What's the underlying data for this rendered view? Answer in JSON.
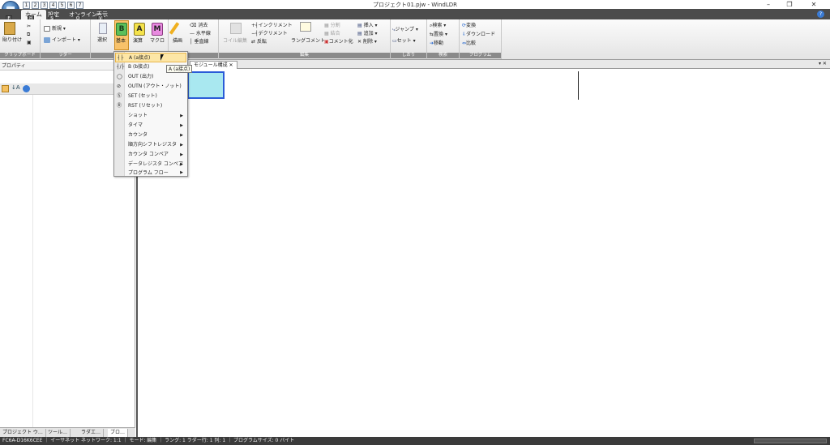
{
  "window": {
    "title": "プロジェクト01.pjw - WindLDR",
    "minimize": "–",
    "restore": "❐",
    "close": "✕"
  },
  "qat": [
    "1",
    "2",
    "3",
    "4",
    "5",
    "6",
    "7"
  ],
  "tabs": [
    {
      "label": "ホーム",
      "key": "H"
    },
    {
      "label": "設定",
      "key": "S"
    },
    {
      "label": "オンライン",
      "key": "O"
    },
    {
      "label": "表示",
      "key": "V"
    }
  ],
  "ribbon": {
    "clipboard": {
      "label": "クリップボード",
      "paste": "貼り付け"
    },
    "ladder": {
      "label": "ラダー",
      "new": "新規",
      "import": "インポート"
    },
    "instructions": {
      "select": "選択",
      "basic": "基本",
      "calc": "演算",
      "macro": "マクロ",
      "draw": "描画",
      "erase": "消去",
      "hline": "水平線",
      "vline": "垂直線",
      "basic_key": "B",
      "calc_key": "A",
      "macro_key": "M"
    },
    "edit": {
      "label": "編集",
      "coil": "コイル編集",
      "increment": "インクリメント",
      "decrement": "デクリメント",
      "invert": "反転",
      "ladder_comment": "ラングコメント",
      "split": "分割",
      "merge": "結合",
      "comment": "コメント化",
      "insert": "挿入",
      "add": "追加",
      "delete": "削除"
    },
    "bookmark": {
      "label": "しおり",
      "jump": "ジャンプ",
      "set": "セット"
    },
    "search": {
      "label": "検索",
      "find": "検索",
      "replace": "置換",
      "move": "移動"
    },
    "program": {
      "label": "プログラム",
      "convert": "変換",
      "download": "ダウンロード",
      "compare": "比較"
    }
  },
  "properties": {
    "title": "プロパティ"
  },
  "bottom_tabs": [
    "プロジェクト ウ…",
    "ツール…",
    "ラダエ…",
    "ブロ…"
  ],
  "doc_tabs": {
    "module": "モジュール構成"
  },
  "menu": {
    "items": [
      {
        "label": "A (a接点)",
        "icon": "a-contact-icon",
        "submenu": false
      },
      {
        "label": "B (b接点)",
        "icon": "b-contact-icon",
        "submenu": false
      },
      {
        "label": "OUT (出力)",
        "icon": "out-coil-icon",
        "submenu": false
      },
      {
        "label": "OUTN (アウト・ノット)",
        "icon": "outn-coil-icon",
        "submenu": false
      },
      {
        "label": "SET (セット)",
        "icon": "set-coil-icon",
        "submenu": false
      },
      {
        "label": "RST (リセット)",
        "icon": "rst-coil-icon",
        "submenu": false
      },
      {
        "label": "ショット",
        "submenu": true
      },
      {
        "label": "タイマ",
        "submenu": true
      },
      {
        "label": "カウンタ",
        "submenu": true
      },
      {
        "label": "順方向シフトレジスタ",
        "submenu": true
      },
      {
        "label": "カウンタ コンペア",
        "submenu": true
      },
      {
        "label": "データレジスタ コンペア",
        "submenu": true
      },
      {
        "label": "プログラム フロー",
        "submenu": true
      }
    ]
  },
  "tooltip": "A (a接点)",
  "status": "FC6A-D16K6CEE ｜ イーサネット  ネットワーク: 1:1 ｜ モード: 編集 ｜ ラング: 1  ラダー行: 1  列: 1 ｜ プログラムサイズ:   0 バイト",
  "colors": {
    "accent": "#2a5bd8",
    "cell": "#a9e8f0",
    "tabbar": "#4c4c4c",
    "highlight": "#fde6a6"
  }
}
